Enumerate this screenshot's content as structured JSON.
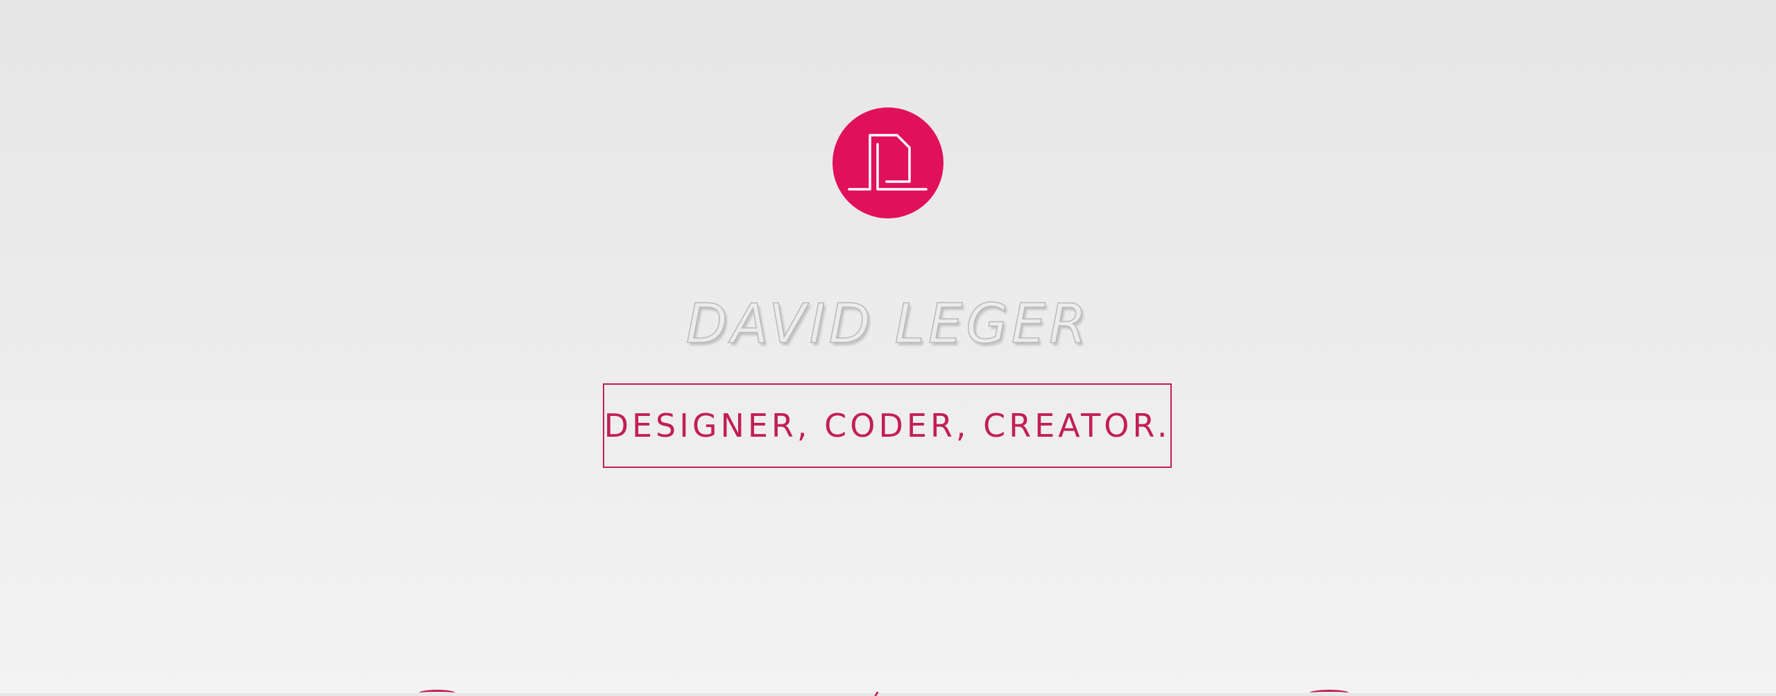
{
  "brand": {
    "logo_icon": "dl-monogram-icon",
    "accent_color": "#e0115a",
    "border_color": "#c21e57"
  },
  "hero": {
    "name": "DAVID LEGER",
    "tagline": "DESIGNER, CODER, CREATOR."
  },
  "next_section_icons": [
    "icon-partial-1",
    "icon-partial-2",
    "icon-partial-3"
  ]
}
